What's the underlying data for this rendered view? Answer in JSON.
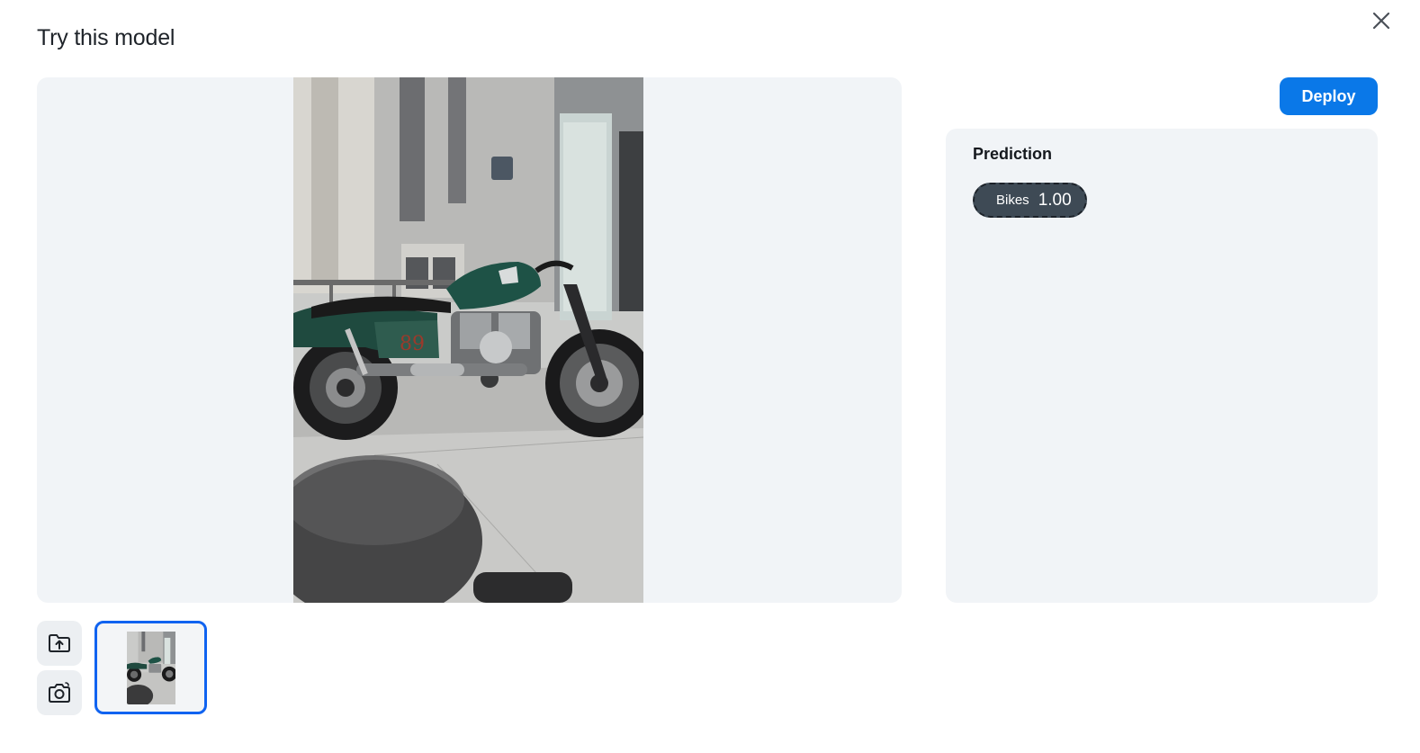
{
  "dialog": {
    "title": "Try this model",
    "close_icon": "close-icon"
  },
  "preview": {
    "image_subject": "motorcycle photo",
    "tank_number": "89"
  },
  "actions": {
    "deploy_label": "Deploy",
    "deploy_color": "#0a78e8"
  },
  "prediction": {
    "title": "Prediction",
    "results": [
      {
        "label": "Bikes",
        "score": "1.00"
      }
    ]
  },
  "toolbar": {
    "upload_icon": "upload-folder-icon",
    "camera_icon": "camera-icon",
    "selected_color": "#1063f0"
  }
}
